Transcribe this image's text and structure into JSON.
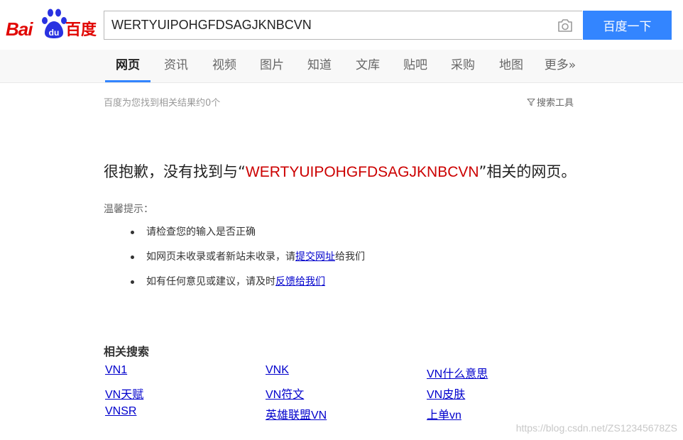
{
  "logo": {
    "latin": "Bai",
    "paw_text": "du",
    "chinese": "百度"
  },
  "search": {
    "query": "WERTYUIPOHGFDSAGJKNBCVN",
    "button_label": "百度一下"
  },
  "nav": {
    "items": [
      {
        "label": "网页",
        "active": true
      },
      {
        "label": "资讯",
        "active": false
      },
      {
        "label": "视频",
        "active": false
      },
      {
        "label": "图片",
        "active": false
      },
      {
        "label": "知道",
        "active": false
      },
      {
        "label": "文库",
        "active": false
      },
      {
        "label": "贴吧",
        "active": false
      },
      {
        "label": "采购",
        "active": false
      },
      {
        "label": "地图",
        "active": false
      },
      {
        "label": "更多»",
        "active": false
      }
    ]
  },
  "result": {
    "count_text": "百度为您找到相关结果约0个",
    "tools_label": "搜索工具"
  },
  "no_result": {
    "prefix": "很抱歉，没有找到与“",
    "query": "WERTYUIPOHGFDSAGJKNBCVN",
    "suffix": "”相关的网页。"
  },
  "tips": {
    "title": "温馨提示：",
    "item1": "请检查您的输入是否正确",
    "item2_prefix": "如网页未收录或者新站未收录，请",
    "item2_link": "提交网址",
    "item2_suffix": "给我们",
    "item3_prefix": "如有任何意见或建议，请及时",
    "item3_link": "反馈给我们"
  },
  "related": {
    "title": "相关搜索",
    "links": [
      [
        "VN1",
        "VNK",
        "VN什么意思"
      ],
      [
        "VN天赋",
        "VN符文",
        "VN皮肤"
      ],
      [
        "VNSR",
        "英雄联盟VN",
        "上单vn"
      ]
    ]
  },
  "watermark": "https://blog.csdn.net/ZS12345678ZS",
  "colors": {
    "brand_red": "#e10602",
    "brand_blue": "#3385ff",
    "link": "#0000cc",
    "query_red": "#cc0000"
  }
}
